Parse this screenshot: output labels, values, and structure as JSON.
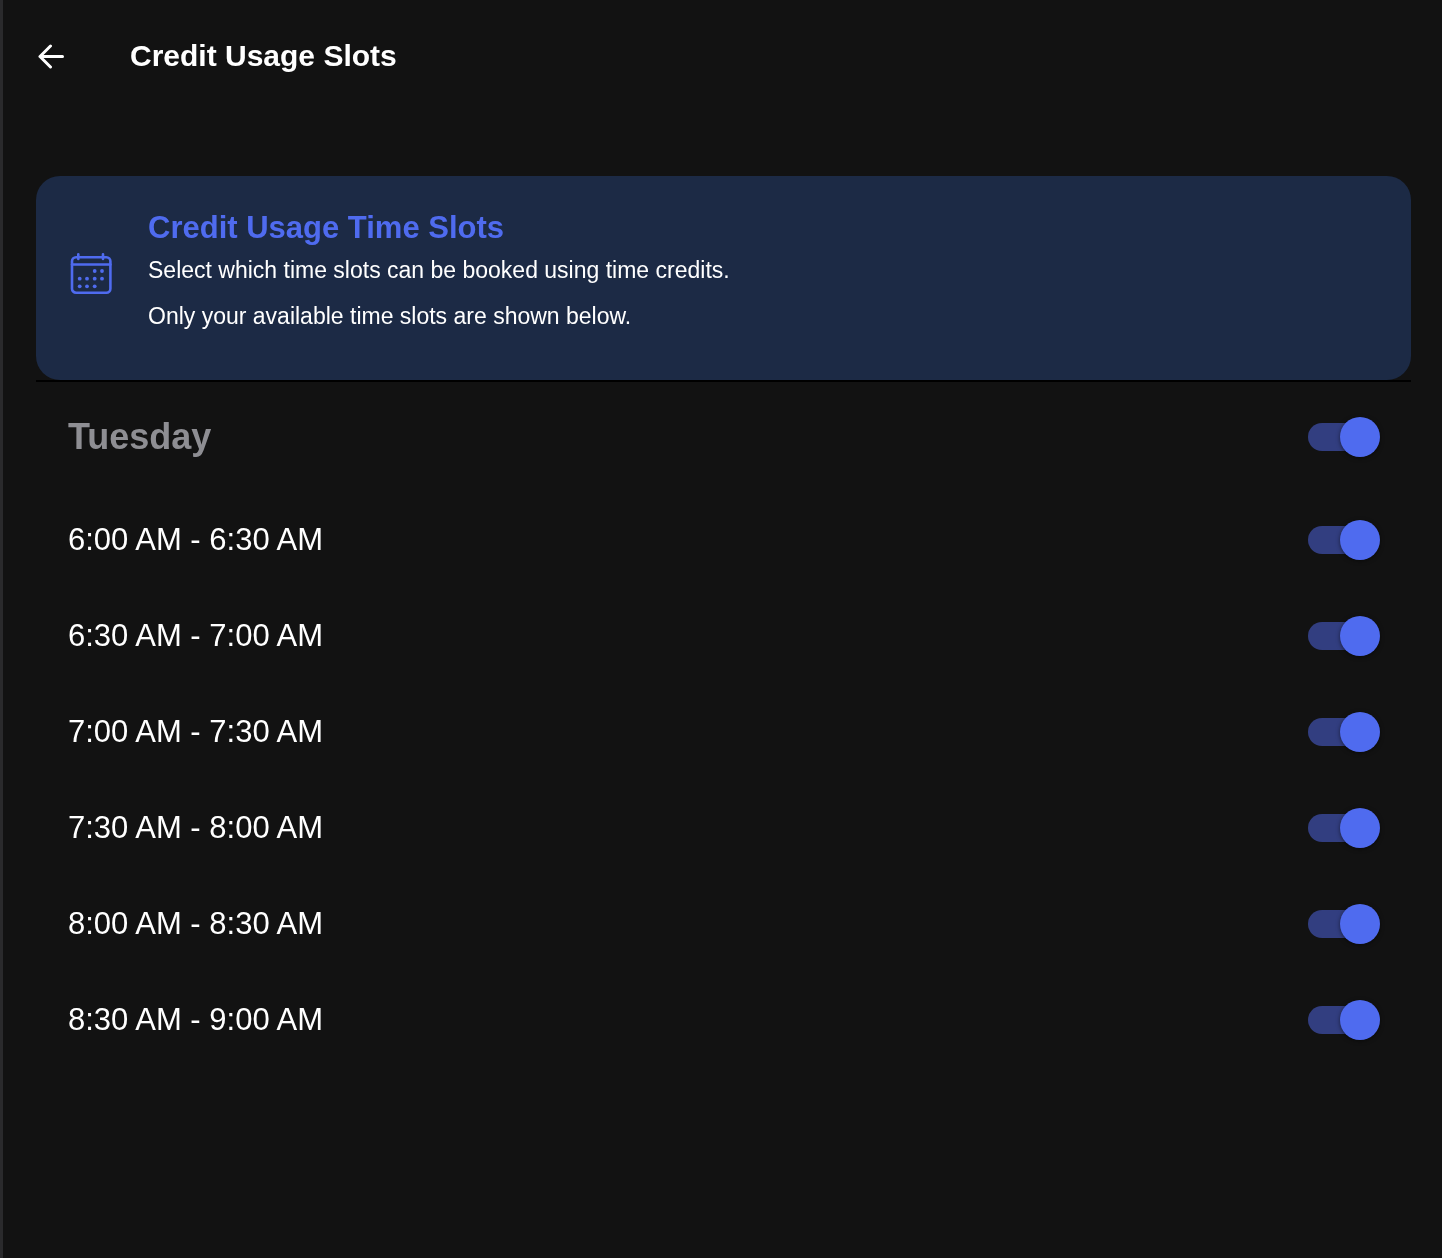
{
  "header": {
    "title": "Credit Usage Slots"
  },
  "info_card": {
    "title": "Credit Usage Time Slots",
    "lines": [
      "Select which time slots can be booked using time credits.",
      "Only your available time slots are shown below."
    ]
  },
  "day": {
    "label": "Tuesday",
    "on": true
  },
  "slots": [
    {
      "label": "6:00 AM - 6:30 AM",
      "on": true
    },
    {
      "label": "6:30 AM - 7:00 AM",
      "on": true
    },
    {
      "label": "7:00 AM - 7:30 AM",
      "on": true
    },
    {
      "label": "7:30 AM - 8:00 AM",
      "on": true
    },
    {
      "label": "8:00 AM - 8:30 AM",
      "on": true
    },
    {
      "label": "8:30 AM - 9:00 AM",
      "on": true
    }
  ]
}
